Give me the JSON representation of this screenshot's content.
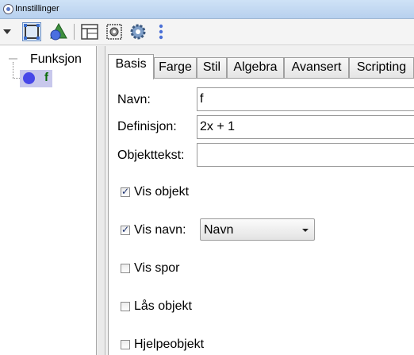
{
  "window": {
    "title": "Innstillinger"
  },
  "tree": {
    "root_label": "Funksjon",
    "items": [
      {
        "label": "f",
        "color": "#4747e8"
      }
    ]
  },
  "tabs": [
    "Basis",
    "Farge",
    "Stil",
    "Algebra",
    "Avansert",
    "Scripting"
  ],
  "basis": {
    "name_label": "Navn:",
    "name_value": "f",
    "definition_label": "Definisjon:",
    "definition_value": "2x + 1",
    "caption_label": "Objekttekst:",
    "caption_value": "",
    "show_object": {
      "label": "Vis objekt",
      "checked": true
    },
    "show_label": {
      "label": "Vis navn:",
      "checked": true,
      "selected": "Navn"
    },
    "trace": {
      "label": "Vis spor",
      "checked": false
    },
    "fix_object": {
      "label": "Lås objekt",
      "checked": false
    },
    "auxiliary": {
      "label": "Hjelpeobjekt",
      "checked": false
    }
  }
}
